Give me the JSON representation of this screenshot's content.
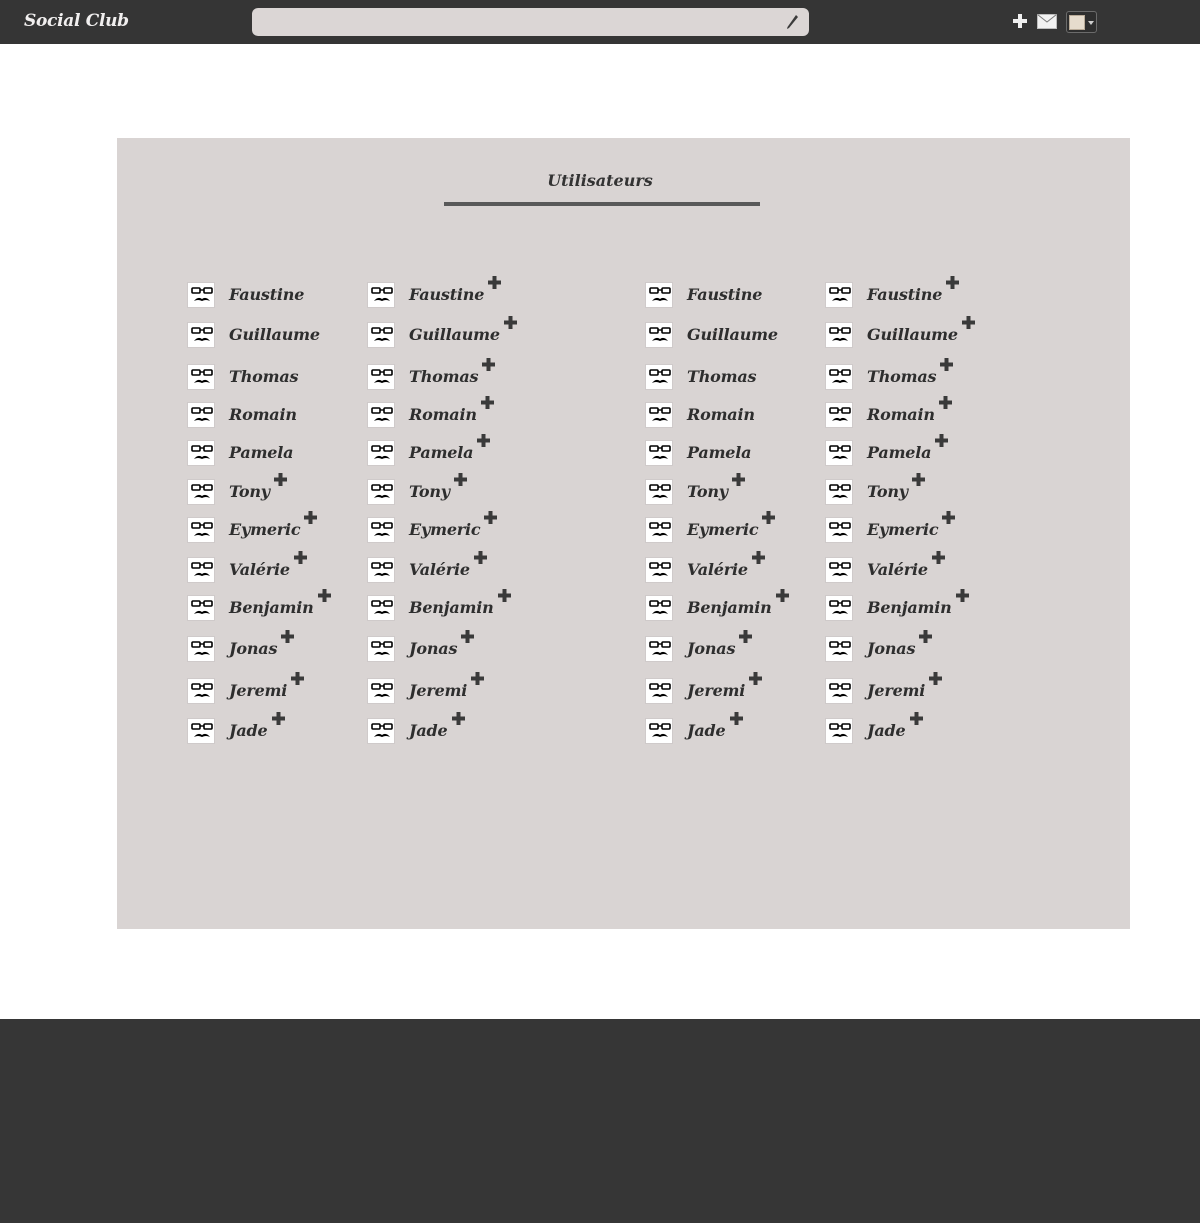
{
  "app": {
    "brand": "Social Club"
  },
  "toolbar": {
    "search_value": "",
    "search_placeholder": "",
    "icons": [
      "edit-pen-icon",
      "plus-icon",
      "mail-icon",
      "user-menu-avatar"
    ]
  },
  "panel": {
    "title": "Utilisateurs"
  },
  "colors": {
    "topbar": "#353535",
    "panel": "#d9d4d3",
    "footer": "#363636",
    "text": "#2e2e2e"
  },
  "columns": [
    {
      "users": [
        {
          "name": "Faustine",
          "addable": false
        },
        {
          "name": "Guillaume",
          "addable": false
        },
        {
          "name": "Thomas",
          "addable": false
        },
        {
          "name": "Romain",
          "addable": false
        },
        {
          "name": "Pamela",
          "addable": false
        },
        {
          "name": "Tony",
          "addable": true
        },
        {
          "name": "Eymeric",
          "addable": true
        },
        {
          "name": "Valérie",
          "addable": true
        },
        {
          "name": "Benjamin",
          "addable": true
        },
        {
          "name": "Jonas",
          "addable": true
        },
        {
          "name": "Jeremi",
          "addable": true
        },
        {
          "name": "Jade",
          "addable": true
        }
      ]
    },
    {
      "users": [
        {
          "name": "Faustine",
          "addable": true
        },
        {
          "name": "Guillaume",
          "addable": true
        },
        {
          "name": "Thomas",
          "addable": true
        },
        {
          "name": "Romain",
          "addable": true
        },
        {
          "name": "Pamela",
          "addable": true
        },
        {
          "name": "Tony",
          "addable": true
        },
        {
          "name": "Eymeric",
          "addable": true
        },
        {
          "name": "Valérie",
          "addable": true
        },
        {
          "name": "Benjamin",
          "addable": true
        },
        {
          "name": "Jonas",
          "addable": true
        },
        {
          "name": "Jeremi",
          "addable": true
        },
        {
          "name": "Jade",
          "addable": true
        }
      ]
    },
    {
      "users": [
        {
          "name": "Faustine",
          "addable": false
        },
        {
          "name": "Guillaume",
          "addable": false
        },
        {
          "name": "Thomas",
          "addable": false
        },
        {
          "name": "Romain",
          "addable": false
        },
        {
          "name": "Pamela",
          "addable": false
        },
        {
          "name": "Tony",
          "addable": true
        },
        {
          "name": "Eymeric",
          "addable": true
        },
        {
          "name": "Valérie",
          "addable": true
        },
        {
          "name": "Benjamin",
          "addable": true
        },
        {
          "name": "Jonas",
          "addable": true
        },
        {
          "name": "Jeremi",
          "addable": true
        },
        {
          "name": "Jade",
          "addable": true
        }
      ]
    },
    {
      "users": [
        {
          "name": "Faustine",
          "addable": true
        },
        {
          "name": "Guillaume",
          "addable": true
        },
        {
          "name": "Thomas",
          "addable": true
        },
        {
          "name": "Romain",
          "addable": true
        },
        {
          "name": "Pamela",
          "addable": true
        },
        {
          "name": "Tony",
          "addable": true
        },
        {
          "name": "Eymeric",
          "addable": true
        },
        {
          "name": "Valérie",
          "addable": true
        },
        {
          "name": "Benjamin",
          "addable": true
        },
        {
          "name": "Jonas",
          "addable": true
        },
        {
          "name": "Jeremi",
          "addable": true
        },
        {
          "name": "Jade",
          "addable": true
        }
      ]
    }
  ]
}
